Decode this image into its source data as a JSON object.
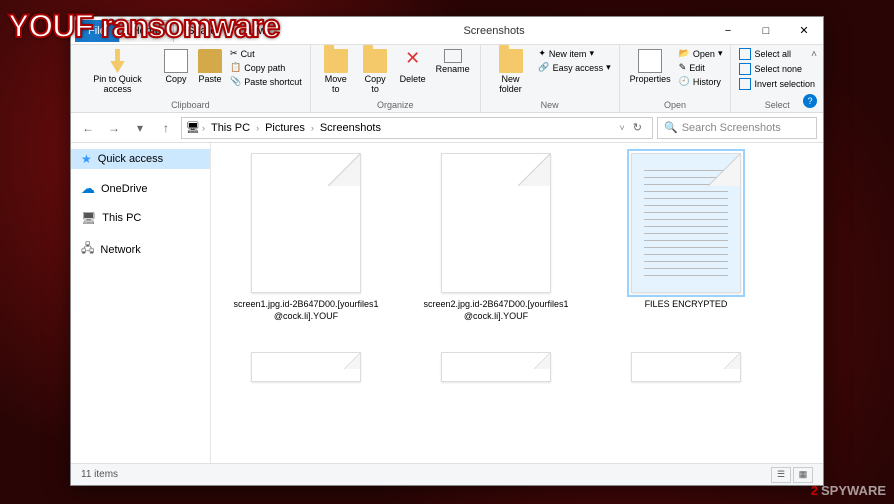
{
  "overlay_title": "YOUF ransomware",
  "watermark": {
    "prefix": "2",
    "suffix": "SPYWARE"
  },
  "window": {
    "tabs": {
      "file": "File",
      "home": "Home",
      "share": "Share",
      "view": "View"
    },
    "title": "Screenshots",
    "controls": {
      "min": "−",
      "max": "□",
      "close": "✕"
    }
  },
  "ribbon": {
    "clipboard": {
      "label": "Clipboard",
      "pin": "Pin to Quick access",
      "copy": "Copy",
      "paste": "Paste",
      "cut": "Cut",
      "copy_path": "Copy path",
      "paste_shortcut": "Paste shortcut"
    },
    "organize": {
      "label": "Organize",
      "move_to": "Move to",
      "copy_to": "Copy to",
      "delete": "Delete",
      "rename": "Rename"
    },
    "new": {
      "label": "New",
      "new_folder": "New folder",
      "new_item": "New item",
      "easy_access": "Easy access"
    },
    "open": {
      "label": "Open",
      "properties": "Properties",
      "open": "Open",
      "edit": "Edit",
      "history": "History"
    },
    "select": {
      "label": "Select",
      "select_all": "Select all",
      "select_none": "Select none",
      "invert": "Invert selection"
    }
  },
  "breadcrumb": {
    "parts": [
      "This PC",
      "Pictures",
      "Screenshots"
    ],
    "refresh": "↻"
  },
  "search": {
    "placeholder": "Search Screenshots"
  },
  "sidebar": {
    "items": [
      {
        "label": "Quick access",
        "icon": "star"
      },
      {
        "label": "OneDrive",
        "icon": "cloud"
      },
      {
        "label": "This PC",
        "icon": "pc"
      },
      {
        "label": "Network",
        "icon": "net"
      }
    ]
  },
  "files": [
    {
      "name": "screen1.jpg.id-2B647D00.[yourfiles1@cock.li].YOUF",
      "thumb": "blank"
    },
    {
      "name": "screen2.jpg.id-2B647D00.[yourfiles1@cock.li].YOUF",
      "thumb": "blank"
    },
    {
      "name": "FILES ENCRYPTED",
      "thumb": "lines"
    }
  ],
  "statusbar": {
    "count": "11 items"
  }
}
